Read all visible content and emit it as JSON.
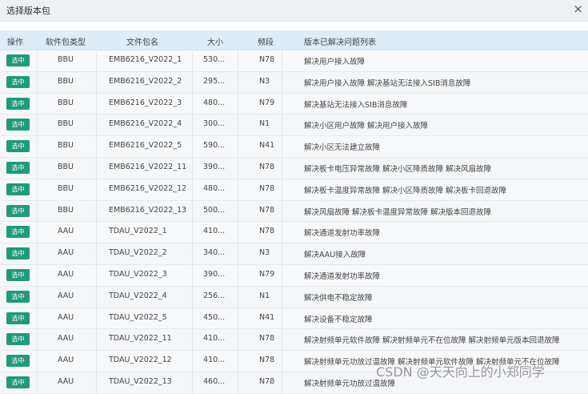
{
  "dialog": {
    "title": "选择版本包",
    "close_icon": "close-icon",
    "close_glyph": "×"
  },
  "table": {
    "headers": {
      "op": "操作",
      "type": "软件包类型",
      "name": "文件包名",
      "size": "大小",
      "band": "频段",
      "desc": "版本已解决问题列表"
    },
    "select_label": "选中",
    "rows": [
      {
        "type": "BBU",
        "name": "EMB6216_V2022_1",
        "size": "530...",
        "band": "N78",
        "desc": "解决用户接入故障"
      },
      {
        "type": "BBU",
        "name": "EMB6216_V2022_2",
        "size": "295...",
        "band": "N3",
        "desc": "解决用户接入故障  解决基站无法接入SIB消息故障"
      },
      {
        "type": "BBU",
        "name": "EMB6216_V2022_3",
        "size": "480...",
        "band": "N79",
        "desc": "解决基站无法接入SIB消息故障"
      },
      {
        "type": "BBU",
        "name": "EMB6216_V2022_4",
        "size": "300...",
        "band": "N1",
        "desc": "解决小区用户故障  解决用户接入故障"
      },
      {
        "type": "BBU",
        "name": "EMB6216_V2022_5",
        "size": "590...",
        "band": "N41",
        "desc": "解决小区无法建立故障"
      },
      {
        "type": "BBU",
        "name": "EMB6216_V2022_11",
        "size": "390...",
        "band": "N78",
        "desc": "解决板卡电压异常故障  解决小区降质故障  解决风扇故障"
      },
      {
        "type": "BBU",
        "name": "EMB6216_V2022_12",
        "size": "480...",
        "band": "N78",
        "desc": "解决板卡温度异常故障  解决小区降质故障  解决板卡回退故障"
      },
      {
        "type": "BBU",
        "name": "EMB6216_V2022_13",
        "size": "500...",
        "band": "N78",
        "desc": "解决风扇故障  解决板卡温度异常故障  解决版本回退故障"
      },
      {
        "type": "AAU",
        "name": "TDAU_V2022_1",
        "size": "410...",
        "band": "N78",
        "desc": "解决通道发射功率故障"
      },
      {
        "type": "AAU",
        "name": "TDAU_V2022_2",
        "size": "340...",
        "band": "N3",
        "desc": "解决AAU接入故障"
      },
      {
        "type": "AAU",
        "name": "TDAU_V2022_3",
        "size": "390...",
        "band": "N79",
        "desc": "解决通道发射功率故障"
      },
      {
        "type": "AAU",
        "name": "TDAU_V2022_4",
        "size": "256...",
        "band": "N1",
        "desc": "解决供电不稳定故障"
      },
      {
        "type": "AAU",
        "name": "TDAU_V2022_5",
        "size": "450...",
        "band": "N41",
        "desc": "解决设备不稳定故障"
      },
      {
        "type": "AAU",
        "name": "TDAU_V2022_11",
        "size": "410...",
        "band": "N78",
        "desc": "解决射频单元软件故障  解决射频单元不在位故障  解决射频单元版本回退故障"
      },
      {
        "type": "AAU",
        "name": "TDAU_V2022_12",
        "size": "410...",
        "band": "N78",
        "desc": "解决射频单元功放过温故障  解决射频单元软件故障  解决射频单元不在位故障"
      },
      {
        "type": "AAU",
        "name": "TDAU_V2022_13",
        "size": "460...",
        "band": "N78",
        "desc": "解决射频单元功放过温故障"
      }
    ]
  },
  "watermark": "CSDN @天天向上的小郑同学"
}
